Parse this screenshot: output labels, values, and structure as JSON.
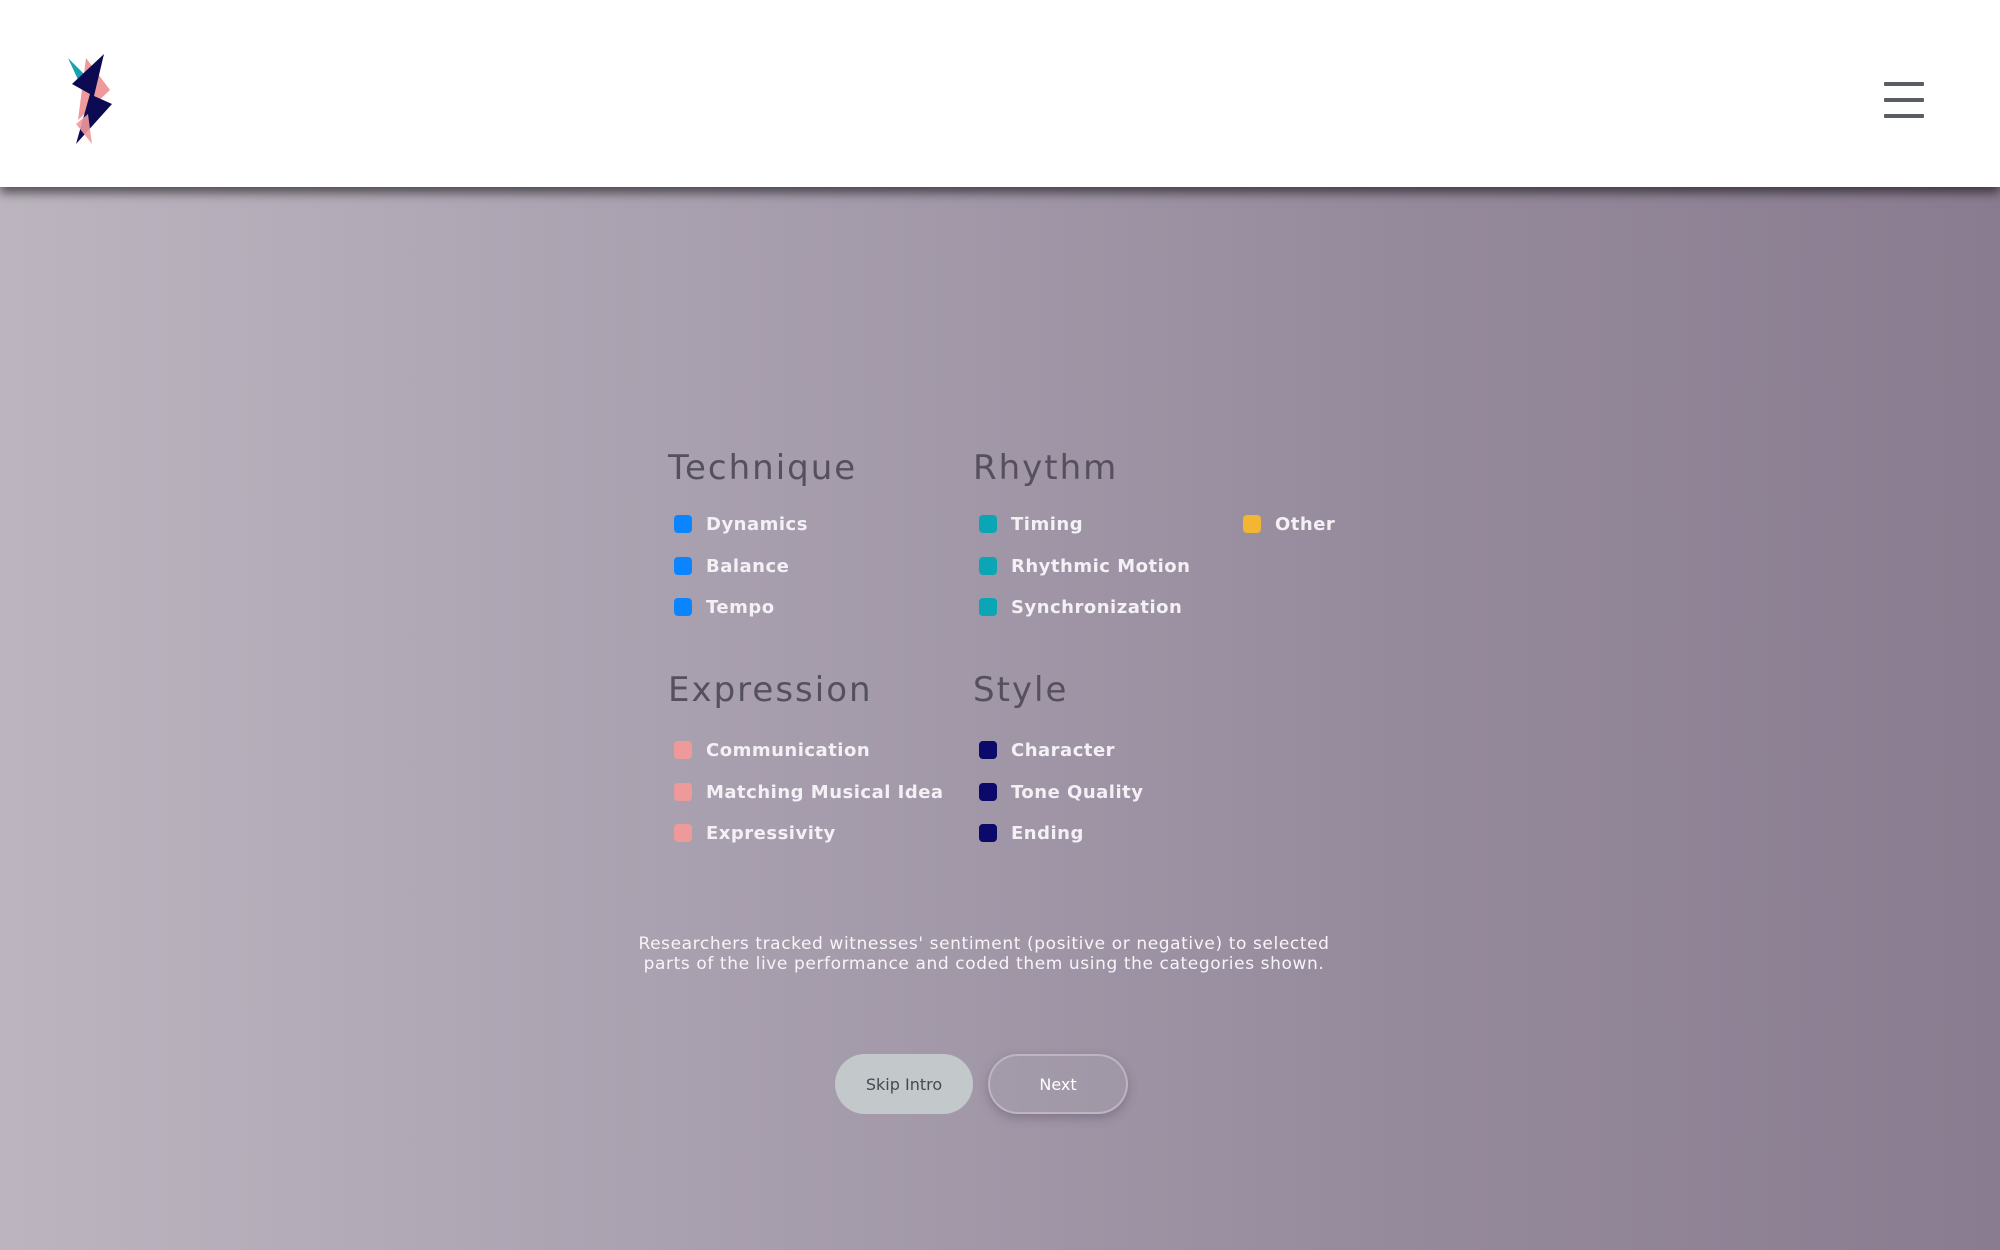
{
  "header": {
    "logo_name": "lightning-logo",
    "menu_icon": "hamburger-menu-icon"
  },
  "legend": {
    "technique": {
      "title": "Technique",
      "color": "#0a84ff",
      "items": [
        "Dynamics",
        "Balance",
        "Tempo"
      ]
    },
    "rhythm": {
      "title": "Rhythm",
      "color": "#0aa6b5",
      "items": [
        "Timing",
        "Rhythmic Motion",
        "Synchronization"
      ]
    },
    "other": {
      "title": "",
      "color": "#f2b632",
      "items": [
        "Other"
      ]
    },
    "expression": {
      "title": "Expression",
      "color": "#ef9a9a",
      "items": [
        "Communication",
        "Matching Musical Idea",
        "Expressivity"
      ]
    },
    "style": {
      "title": "Style",
      "color": "#0b0a6a",
      "items": [
        "Character",
        "Tone Quality",
        "Ending"
      ]
    }
  },
  "caption": {
    "line1": "Researchers tracked witnesses' sentiment (positive or negative)  to selected",
    "line2": "parts of the live performance and coded them using the categories shown."
  },
  "buttons": {
    "skip_label": "Skip Intro",
    "next_label": "Next"
  }
}
